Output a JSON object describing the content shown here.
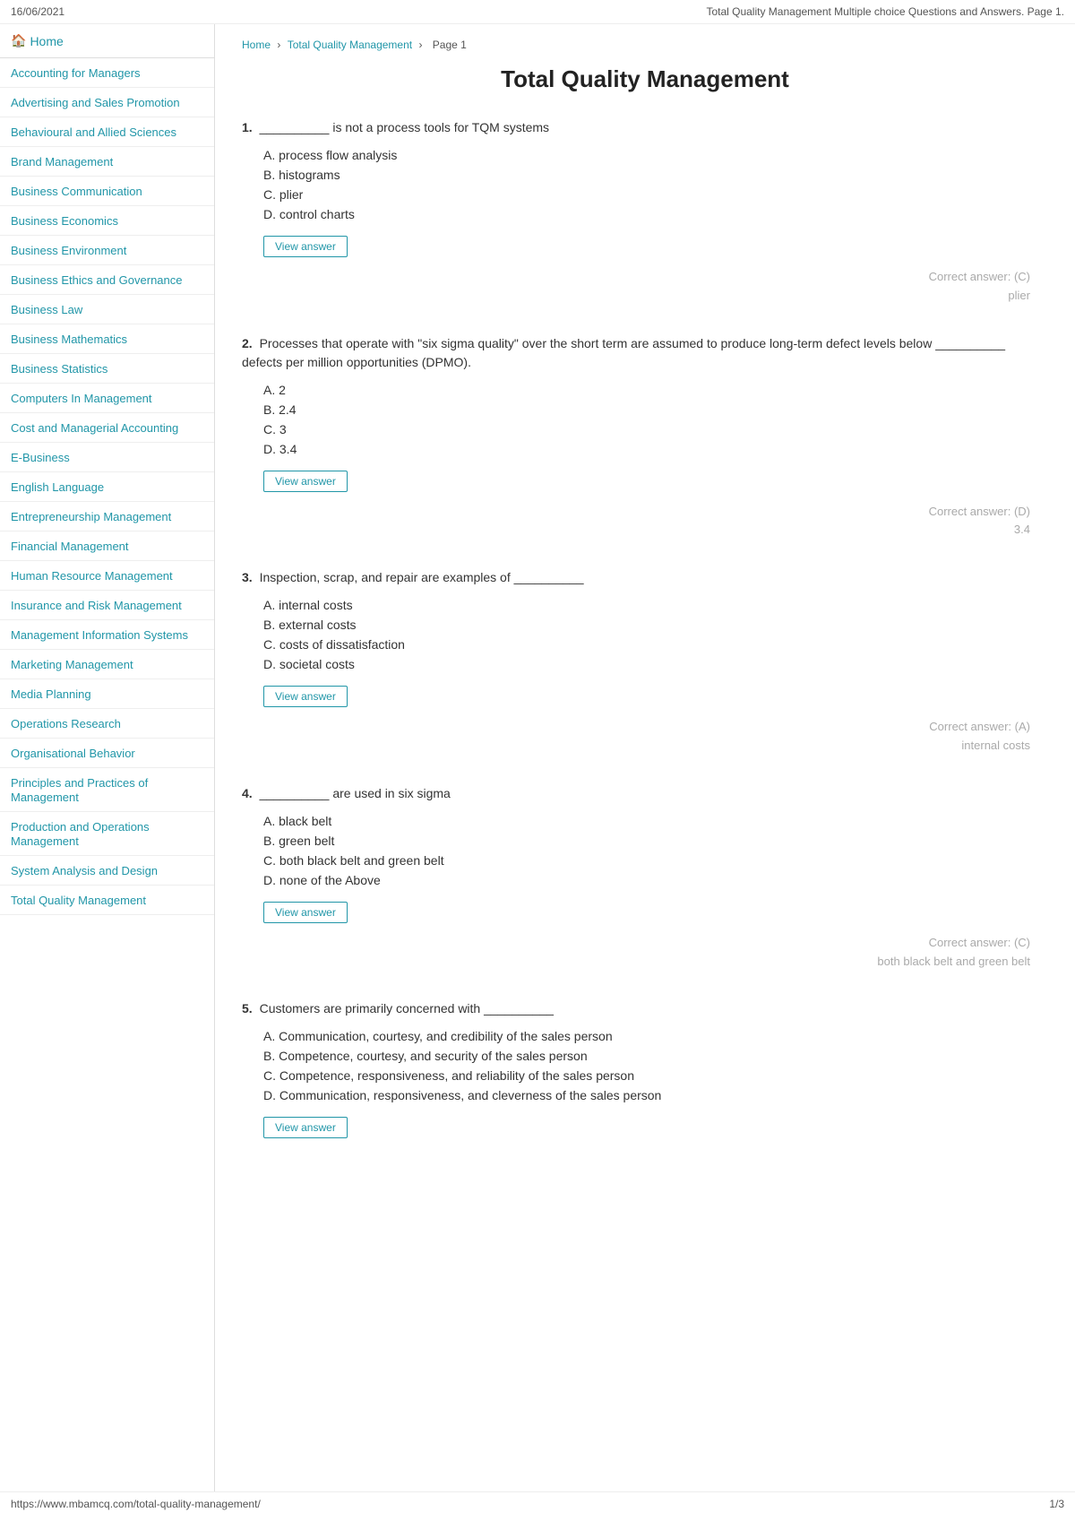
{
  "topBar": {
    "date": "16/06/2021",
    "pageTitle": "Total Quality Management Multiple choice Questions and Answers. Page 1."
  },
  "sidebar": {
    "homeLabel": "Home",
    "items": [
      {
        "label": "Accounting for Managers"
      },
      {
        "label": "Advertising and Sales Promotion"
      },
      {
        "label": "Behavioural and Allied Sciences"
      },
      {
        "label": "Brand Management"
      },
      {
        "label": "Business Communication"
      },
      {
        "label": "Business Economics"
      },
      {
        "label": "Business Environment"
      },
      {
        "label": "Business Ethics and Governance"
      },
      {
        "label": "Business Law"
      },
      {
        "label": "Business Mathematics"
      },
      {
        "label": "Business Statistics"
      },
      {
        "label": "Computers In Management"
      },
      {
        "label": "Cost and Managerial Accounting"
      },
      {
        "label": "E-Business"
      },
      {
        "label": "English Language"
      },
      {
        "label": "Entrepreneurship Management"
      },
      {
        "label": "Financial Management"
      },
      {
        "label": "Human Resource Management"
      },
      {
        "label": "Insurance and Risk Management"
      },
      {
        "label": "Management Information Systems"
      },
      {
        "label": "Marketing Management"
      },
      {
        "label": "Media Planning"
      },
      {
        "label": "Operations Research"
      },
      {
        "label": "Organisational Behavior"
      },
      {
        "label": "Principles and Practices of Management"
      },
      {
        "label": "Production and Operations Management"
      },
      {
        "label": "System Analysis and Design"
      },
      {
        "label": "Total Quality Management"
      }
    ]
  },
  "breadcrumb": {
    "home": "Home",
    "section": "Total Quality Management",
    "page": "Page 1"
  },
  "heading": "Total Quality Management",
  "questions": [
    {
      "number": "1.",
      "text": "__________ is not a process tools for TQM systems",
      "options": [
        {
          "label": "A.",
          "text": "process flow analysis"
        },
        {
          "label": "B.",
          "text": "histograms"
        },
        {
          "label": "C.",
          "text": "plier"
        },
        {
          "label": "D.",
          "text": "control charts"
        }
      ],
      "viewAnswerLabel": "View answer",
      "correctAnswer": "Correct answer: (C)",
      "correctAnswerDetail": "plier"
    },
    {
      "number": "2.",
      "text": "Processes that operate with \"six sigma quality\" over the short term are assumed to produce long-term defect levels below __________ defects per million opportunities (DPMO).",
      "options": [
        {
          "label": "A.",
          "text": "2"
        },
        {
          "label": "B.",
          "text": "2.4"
        },
        {
          "label": "C.",
          "text": "3"
        },
        {
          "label": "D.",
          "text": "3.4"
        }
      ],
      "viewAnswerLabel": "View answer",
      "correctAnswer": "Correct answer: (D)",
      "correctAnswerDetail": "3.4"
    },
    {
      "number": "3.",
      "text": "Inspection, scrap, and repair are examples of __________",
      "options": [
        {
          "label": "A.",
          "text": "internal costs"
        },
        {
          "label": "B.",
          "text": "external costs"
        },
        {
          "label": "C.",
          "text": "costs of dissatisfaction"
        },
        {
          "label": "D.",
          "text": "societal costs"
        }
      ],
      "viewAnswerLabel": "View answer",
      "correctAnswer": "Correct answer: (A)",
      "correctAnswerDetail": "internal costs"
    },
    {
      "number": "4.",
      "text": "__________ are used in six sigma",
      "options": [
        {
          "label": "A.",
          "text": "black belt"
        },
        {
          "label": "B.",
          "text": "green belt"
        },
        {
          "label": "C.",
          "text": "both black belt and green belt"
        },
        {
          "label": "D.",
          "text": "none of the Above"
        }
      ],
      "viewAnswerLabel": "View answer",
      "correctAnswer": "Correct answer: (C)",
      "correctAnswerDetail": "both black belt and green belt"
    },
    {
      "number": "5.",
      "text": "Customers are primarily concerned with __________",
      "options": [
        {
          "label": "A.",
          "text": "Communication, courtesy, and credibility of the sales person"
        },
        {
          "label": "B.",
          "text": "Competence, courtesy, and security of the sales person"
        },
        {
          "label": "C.",
          "text": "Competence, responsiveness, and reliability of the sales person"
        },
        {
          "label": "D.",
          "text": "Communication, responsiveness, and cleverness of the sales person"
        }
      ],
      "viewAnswerLabel": "View answer",
      "correctAnswer": "",
      "correctAnswerDetail": ""
    }
  ],
  "bottomBar": {
    "url": "https://www.mbamcq.com/total-quality-management/",
    "pagination": "1/3"
  }
}
